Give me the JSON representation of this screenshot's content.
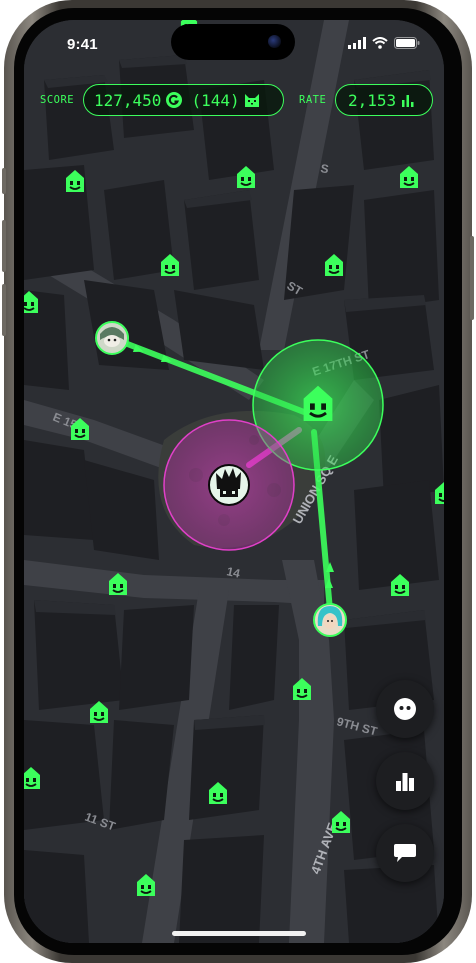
{
  "status_bar": {
    "time": "9:41"
  },
  "hud": {
    "score_label": "SCORE",
    "score_value": "127,450",
    "score_currency_icon": "coin-g-icon",
    "cat_count": "(144)",
    "cat_icon": "cat-face-icon",
    "rate_label": "RATE",
    "rate_value": "2,153",
    "rate_icon": "bar-chart-icon"
  },
  "map": {
    "street_labels": [
      "E 17TH ST",
      "ST",
      "E 15",
      "UNION SQ E",
      "14",
      "4TH AVE",
      "9TH ST",
      "11 ST",
      "S"
    ],
    "marker_icon": "house-smiley-icon",
    "player_markers": [
      "player-avatar-hooded",
      "player-avatar-teal-hair"
    ],
    "zone_icons": [
      "green-zone-house-smiley",
      "magenta-zone-spiky-creature"
    ]
  },
  "fabs": [
    {
      "icon": "smiley-face-icon"
    },
    {
      "icon": "leaderboard-icon"
    },
    {
      "icon": "chat-bubble-icon"
    }
  ],
  "colors": {
    "accent_green": "#3cff5c",
    "accent_magenta": "#e040c8",
    "map_ground": "#2c2e33",
    "building": "#1e1f23"
  }
}
